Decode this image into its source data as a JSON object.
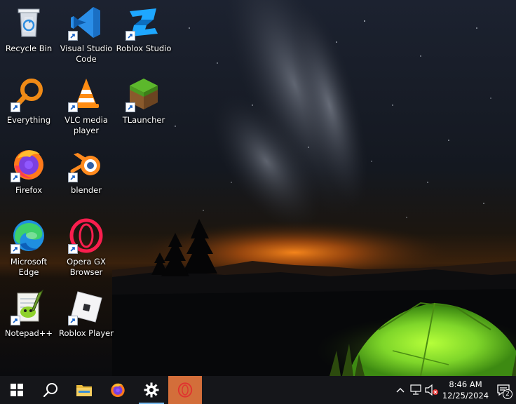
{
  "desktop": {
    "icons": [
      {
        "label": "Recycle Bin",
        "icon": "recycle-bin-icon",
        "shortcut": false
      },
      {
        "label": "Visual Studio\nCode",
        "icon": "vscode-icon",
        "shortcut": true
      },
      {
        "label": "Roblox Studio",
        "icon": "roblox-studio-icon",
        "shortcut": true
      },
      {
        "label": "Everything",
        "icon": "everything-search-icon",
        "shortcut": true
      },
      {
        "label": "VLC media\nplayer",
        "icon": "vlc-icon",
        "shortcut": true
      },
      {
        "label": "TLauncher",
        "icon": "tlauncher-icon",
        "shortcut": true
      },
      {
        "label": "Firefox",
        "icon": "firefox-icon",
        "shortcut": true
      },
      {
        "label": "blender",
        "icon": "blender-icon",
        "shortcut": true
      },
      {
        "label": "Microsoft\nEdge",
        "icon": "edge-icon",
        "shortcut": true
      },
      {
        "label": "Opera GX\nBrowser",
        "icon": "opera-gx-icon",
        "shortcut": true
      },
      {
        "label": "Notepad++",
        "icon": "notepad-plus-plus-icon",
        "shortcut": true
      },
      {
        "label": "Roblox Player",
        "icon": "roblox-player-icon",
        "shortcut": true
      }
    ]
  },
  "taskbar": {
    "buttons": [
      "start-icon",
      "search-icon",
      "file-explorer-icon",
      "firefox-icon",
      "settings-icon",
      "opera-gx-icon"
    ],
    "tray": {
      "show_hidden": "chevron-up-icon",
      "network": "network-icon",
      "volume": "volume-muted-icon",
      "time": "8:46 AM",
      "date": "12/25/2024",
      "notifications": "2"
    }
  },
  "colors": {
    "taskbar": "#15161a",
    "active_indicator": "#76b9ed",
    "opera_highlight": "#d36e3a",
    "tent": "#7fd62a",
    "horizon_glow": "#e07a1e"
  }
}
